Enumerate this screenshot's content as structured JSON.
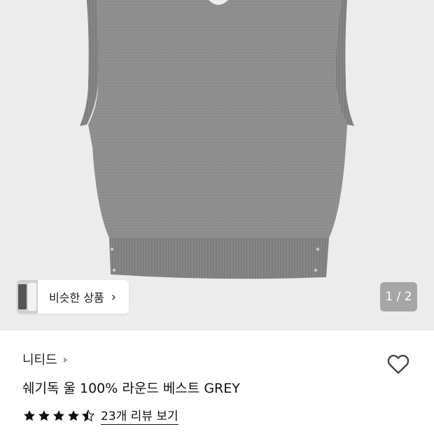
{
  "gallery": {
    "similar_label": "비슷한 상품",
    "page_indicator": "1 / 2"
  },
  "product": {
    "brand": "니티드",
    "title": "쉐기독 울 100% 라운드 베스트 GREY"
  },
  "rating": {
    "value": 4.5,
    "max": 5,
    "review_link": "23개 리뷰 보기"
  },
  "colors": {
    "vest": "#8f8f8f",
    "background": "#ececec",
    "star": "#111111"
  }
}
